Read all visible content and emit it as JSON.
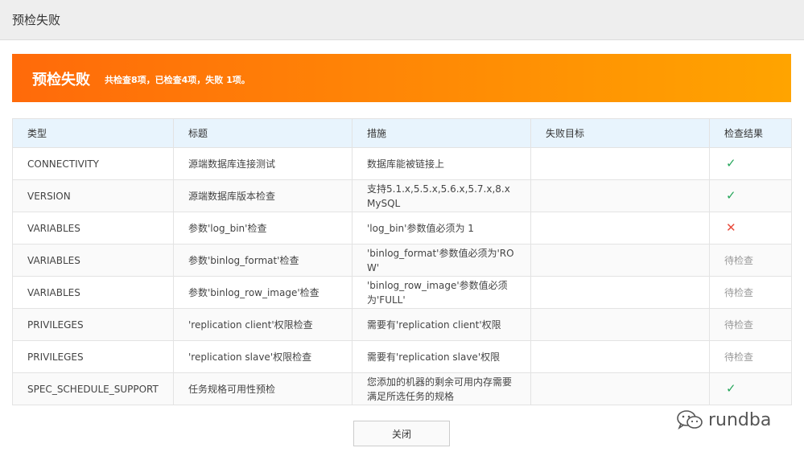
{
  "header": {
    "title": "预检失败"
  },
  "banner": {
    "title": "预检失败",
    "summary": "共检查8项，已检查4项，失败 1项。"
  },
  "table": {
    "columns": [
      "类型",
      "标题",
      "措施",
      "失败目标",
      "检查结果"
    ],
    "rows": [
      {
        "type": "CONNECTIVITY",
        "title": "源端数据库连接测试",
        "measure": "数据库能被链接上",
        "target": "",
        "status": "pass",
        "status_text": "✓"
      },
      {
        "type": "VERSION",
        "title": "源端数据库版本检查",
        "measure": "支持5.1.x,5.5.x,5.6.x,5.7.x,8.x MySQL",
        "target": "",
        "status": "pass",
        "status_text": "✓"
      },
      {
        "type": "VARIABLES",
        "title": "参数'log_bin'检查",
        "measure": "'log_bin'参数值必须为 1",
        "target": "",
        "status": "fail",
        "status_text": "✕"
      },
      {
        "type": "VARIABLES",
        "title": "参数'binlog_format'检查",
        "measure": "'binlog_format'参数值必须为'ROW'",
        "target": "",
        "status": "pending",
        "status_text": "待检查"
      },
      {
        "type": "VARIABLES",
        "title": "参数'binlog_row_image'检查",
        "measure": "'binlog_row_image'参数值必须为'FULL'",
        "target": "",
        "status": "pending",
        "status_text": "待检查"
      },
      {
        "type": "PRIVILEGES",
        "title": "'replication client'权限检查",
        "measure": "需要有'replication client'权限",
        "target": "",
        "status": "pending",
        "status_text": "待检查"
      },
      {
        "type": "PRIVILEGES",
        "title": "'replication slave'权限检查",
        "measure": "需要有'replication slave'权限",
        "target": "",
        "status": "pending",
        "status_text": "待检查"
      },
      {
        "type": "SPEC_SCHEDULE_SUPPORT",
        "title": "任务规格可用性预检",
        "measure": "您添加的机器的剩余可用内存需要满足所选任务的规格",
        "target": "",
        "status": "pass",
        "status_text": "✓"
      }
    ]
  },
  "footer": {
    "close_label": "关闭"
  },
  "watermark": {
    "text": "rundba",
    "icon": "wechat-icon"
  },
  "colors": {
    "banner_start": "#ff6a0a",
    "banner_end": "#ffa400",
    "pass": "#26a65b",
    "fail": "#e84b3c",
    "pending": "#999999",
    "header_bg": "#e8f4fd"
  }
}
